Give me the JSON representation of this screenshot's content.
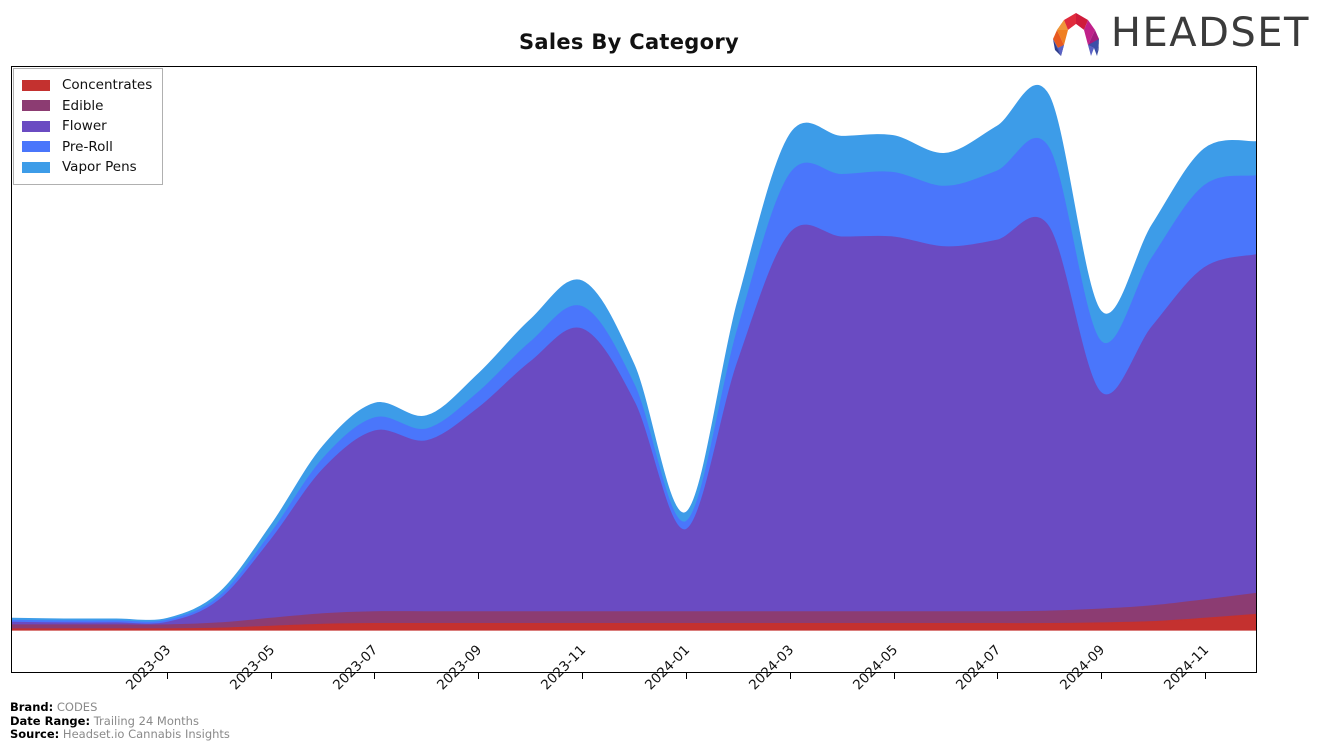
{
  "header": {
    "title": "Sales By Category",
    "logo_word": "HEADSET",
    "logo_mark_name": "headset-arch-logo"
  },
  "footer": {
    "brand_key": "Brand:",
    "brand_value": "CODES",
    "date_range_key": "Date Range:",
    "date_range_value": "Trailing 24 Months",
    "source_key": "Source:",
    "source_value": "Headset.io Cannabis Insights"
  },
  "colors": {
    "concentrates": "#c4312f",
    "edible": "#8c3c72",
    "flower": "#6a4bc2",
    "preroll": "#4a76fb",
    "vaporpens": "#3d9ce8",
    "axis": "#000000",
    "footer_value": "#8a8a8a"
  },
  "chart_data": {
    "type": "area",
    "stacked": true,
    "title": "Sales By Category",
    "xlabel": "",
    "ylabel": "",
    "grid": false,
    "legend_position": "upper-left",
    "x_tick_labels": [
      "2023-03",
      "2023-05",
      "2023-07",
      "2023-09",
      "2023-11",
      "2024-01",
      "2024-03",
      "2024-05",
      "2024-07",
      "2024-09",
      "2024-11"
    ],
    "x": [
      "2022-12",
      "2023-01",
      "2023-02",
      "2023-03",
      "2023-04",
      "2023-05",
      "2023-06",
      "2023-07",
      "2023-08",
      "2023-09",
      "2023-10",
      "2023-11",
      "2023-12",
      "2024-01",
      "2024-02",
      "2024-03",
      "2024-04",
      "2024-05",
      "2024-06",
      "2024-07",
      "2024-08",
      "2024-09",
      "2024-10",
      "2024-11",
      "2024-12"
    ],
    "series": [
      {
        "name": "Concentrates",
        "color": "#c4312f",
        "values": [
          0.2,
          0.2,
          0.2,
          0.2,
          0.3,
          0.6,
          0.9,
          1.0,
          1.0,
          1.0,
          1.0,
          1.0,
          1.0,
          1.0,
          1.0,
          1.0,
          1.0,
          1.0,
          1.0,
          1.0,
          1.0,
          1.1,
          1.3,
          1.8,
          2.4
        ]
      },
      {
        "name": "Edible",
        "color": "#8c3c72",
        "values": [
          0.6,
          0.6,
          0.6,
          0.6,
          0.8,
          1.2,
          1.6,
          1.8,
          1.8,
          1.8,
          1.8,
          1.8,
          1.8,
          1.8,
          1.8,
          1.8,
          1.8,
          1.8,
          1.8,
          1.8,
          1.9,
          2.1,
          2.4,
          2.8,
          3.2
        ]
      },
      {
        "name": "Flower",
        "color": "#6a4bc2",
        "values": [
          0.4,
          0.3,
          0.3,
          0.4,
          3.5,
          12.0,
          22.0,
          27.5,
          26.0,
          31.0,
          38.0,
          43.0,
          32.0,
          12.5,
          38.0,
          57.5,
          57.0,
          57.0,
          55.5,
          56.5,
          58.5,
          33.0,
          42.5,
          50.5,
          51.5
        ]
      },
      {
        "name": "Pre-Roll",
        "color": "#4a76fb",
        "values": [
          0.3,
          0.3,
          0.3,
          0.3,
          0.5,
          1.0,
          1.6,
          2.0,
          1.8,
          2.4,
          3.0,
          3.4,
          2.6,
          1.2,
          5.0,
          9.0,
          9.5,
          9.8,
          9.2,
          10.5,
          12.0,
          7.8,
          10.5,
          12.5,
          12.0
        ]
      },
      {
        "name": "Vapor Pens",
        "color": "#3d9ce8",
        "values": [
          0.3,
          0.3,
          0.3,
          0.3,
          0.6,
          1.2,
          1.9,
          2.2,
          2.0,
          2.8,
          3.4,
          3.9,
          3.0,
          1.4,
          4.2,
          6.0,
          5.8,
          5.6,
          5.0,
          6.8,
          8.0,
          4.6,
          5.0,
          5.6,
          5.2
        ]
      }
    ],
    "legend_entries": [
      "Concentrates",
      "Edible",
      "Flower",
      "Pre-Roll",
      "Vapor Pens"
    ]
  }
}
